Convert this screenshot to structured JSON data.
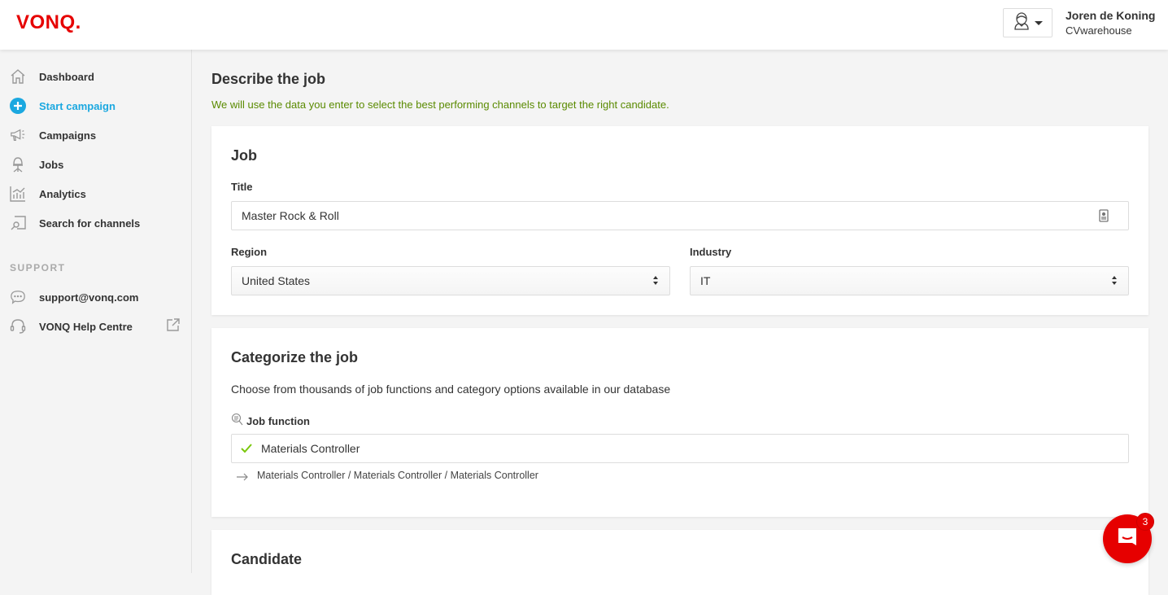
{
  "header": {
    "logo": "VONQ.",
    "user_name": "Joren de Koning",
    "user_company": "CVwarehouse"
  },
  "sidebar": {
    "items": [
      {
        "label": "Dashboard",
        "icon": "home-icon",
        "active": false
      },
      {
        "label": "Start campaign",
        "icon": "plus-circle-icon",
        "active": true
      },
      {
        "label": "Campaigns",
        "icon": "megaphone-icon",
        "active": false
      },
      {
        "label": "Jobs",
        "icon": "chair-icon",
        "active": false
      },
      {
        "label": "Analytics",
        "icon": "chart-icon",
        "active": false
      },
      {
        "label": "Search for channels",
        "icon": "search-channels-icon",
        "active": false
      }
    ],
    "support_heading": "SUPPORT",
    "support_items": [
      {
        "label": "support@vonq.com",
        "icon": "chat-bubble-icon"
      },
      {
        "label": "VONQ Help Centre",
        "icon": "headset-icon",
        "trailing_icon": "external-link-icon"
      }
    ]
  },
  "main": {
    "title": "Describe the job",
    "subtitle": "We will use the data you enter to select the best performing channels to target the right candidate.",
    "job_card": {
      "title": "Job",
      "title_label": "Title",
      "title_value": "Master Rock & Roll",
      "region_label": "Region",
      "region_value": "United States",
      "industry_label": "Industry",
      "industry_value": "IT"
    },
    "categorize_card": {
      "title": "Categorize the job",
      "description": "Choose from thousands of job functions and category options available in our database",
      "job_function_label": "Job function",
      "job_function_value": "Materials Controller",
      "job_function_path": "Materials Controller / Materials Controller / Materials Controller"
    },
    "candidate_card": {
      "title": "Candidate"
    }
  },
  "chat": {
    "badge_count": "3"
  },
  "colors": {
    "brand": "#e60000",
    "active_nav": "#1ba8e0",
    "subtitle_green": "#5a8a00",
    "check_green": "#7ac70c"
  }
}
